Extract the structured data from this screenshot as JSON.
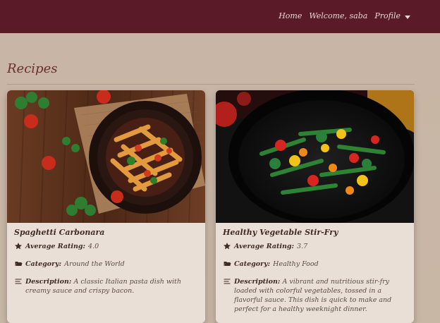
{
  "nav": {
    "home": "Home",
    "welcome": "Welcome, saba",
    "profile": "Profile"
  },
  "main": {
    "title": "Recipes"
  },
  "recipes": [
    {
      "name": "Spaghetti Carbonara",
      "average_rating_label": "Average Rating:",
      "average_rating_value": "4.0",
      "category_label": "Category:",
      "category_value": "Around the World",
      "description_label": "Description:",
      "description_value": "A classic Italian pasta dish with creamy sauce and crispy bacon."
    },
    {
      "name": "Healthy Vegetable Stir-Fry",
      "average_rating_label": "Average Rating:",
      "average_rating_value": "3.7",
      "category_label": "Category:",
      "category_value": "Healthy Food",
      "description_label": "Description:",
      "description_value": "A vibrant and nutritious stir-fry loaded with colorful vegetables, tossed in a flavorful sauce. This dish is quick to make and perfect for a healthy weeknight dinner."
    }
  ],
  "icons": {
    "rating": "star-icon",
    "category": "folder-open-icon",
    "description": "list-icon",
    "profile_caret": "chevron-down-icon"
  }
}
